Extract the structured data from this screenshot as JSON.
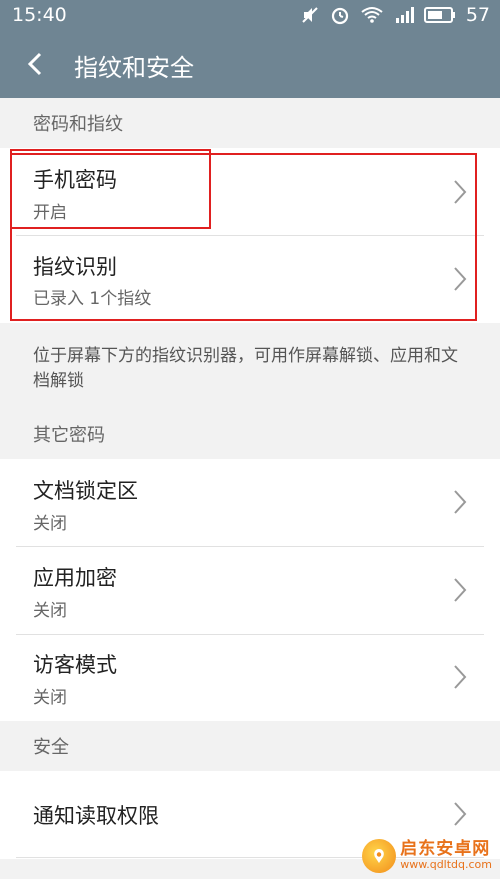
{
  "status_bar": {
    "time": "15:40",
    "battery_level": "57",
    "icons": [
      "mute-icon",
      "alarm-icon",
      "wifi-icon",
      "signal-icon",
      "battery-icon"
    ]
  },
  "app_bar": {
    "title": "指纹和安全",
    "back_icon": "chevron-left-icon"
  },
  "sections": {
    "password_fingerprint": {
      "header": "密码和指纹",
      "items": [
        {
          "label": "手机密码",
          "sub": "开启"
        },
        {
          "label": "指纹识别",
          "sub": "已录入 1个指纹"
        }
      ],
      "description": "位于屏幕下方的指纹识别器，可用作屏幕解锁、应用和文档解锁"
    },
    "other_passwords": {
      "header": "其它密码",
      "items": [
        {
          "label": "文档锁定区",
          "sub": "关闭"
        },
        {
          "label": "应用加密",
          "sub": "关闭"
        },
        {
          "label": "访客模式",
          "sub": "关闭"
        }
      ]
    },
    "security": {
      "header": "安全",
      "items": [
        {
          "label": "通知读取权限"
        }
      ]
    }
  },
  "watermark": {
    "title": "启东安卓网",
    "url": "www.qdltdq.com"
  },
  "colors": {
    "app_bar": "#6f8593",
    "highlight": "#e02020",
    "background": "#f2f2f2"
  }
}
